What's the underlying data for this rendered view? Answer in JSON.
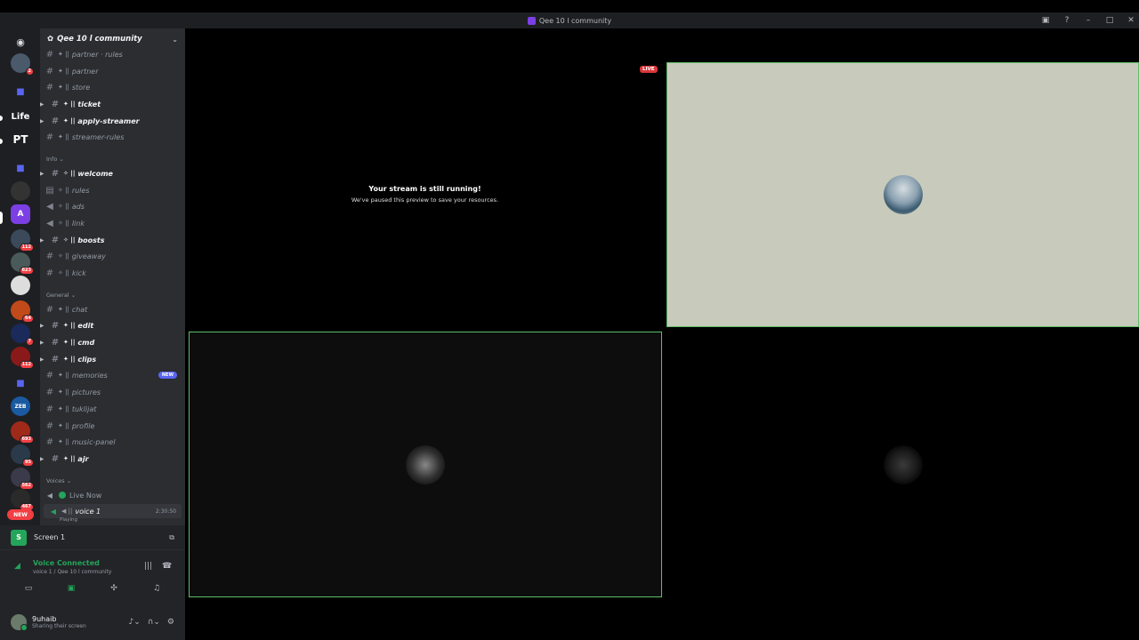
{
  "window": {
    "title": "Qee 10 l community"
  },
  "rail": {
    "labels": {
      "life": "Life",
      "pt": "PT",
      "zeb": "ZEB"
    },
    "badges": {
      "b1": "2",
      "b2": "112",
      "b3": "623",
      "b4": "64",
      "b5": "7",
      "b6": "112",
      "b7": "693",
      "b8": "95",
      "b9": "562",
      "b10": "467",
      "new": "NEW"
    }
  },
  "server": {
    "name": "Qee 10 l community"
  },
  "categories": {
    "info": "Info",
    "general": "General",
    "voices": "Voices"
  },
  "channels": {
    "c1": "partner · rules",
    "c2": "partner",
    "c3": "store",
    "c4": "ticket",
    "c5": "apply-streamer",
    "c6": "streamer-rules",
    "c7": "welcome",
    "c8": "rules",
    "c9": "ads",
    "c10": "link",
    "c11": "boosts",
    "c12": "giveaway",
    "c13": "kick",
    "c14": "chat",
    "c15": "edit",
    "c16": "cmd",
    "c17": "clips",
    "c18": "memories",
    "c19": "pictures",
    "c20": "tuklijat",
    "c21": "profile",
    "c22": "music-panel",
    "c23": "ajr"
  },
  "badge_new": "NEW",
  "voice": {
    "live_now": "Live Now",
    "voice1": "voice 1",
    "timer": "2:30:50",
    "playing": "Playing"
  },
  "panel": {
    "screen_avatar": "S",
    "screen_label": "Screen 1",
    "connected_title": "Voice Connected",
    "connected_sub": "voice 1 / Qee 10 l community"
  },
  "user": {
    "name": "9uhaib",
    "status": "Sharing their screen"
  },
  "stage": {
    "live_badge": "LIVE",
    "paused_title": "Your stream is still running!",
    "paused_sub": "We've paused this preview to save your resources."
  },
  "colors": {
    "accent": "#5865f2",
    "online": "#23a55a",
    "danger": "#f23f43",
    "tile_border": "#5cbf68"
  }
}
